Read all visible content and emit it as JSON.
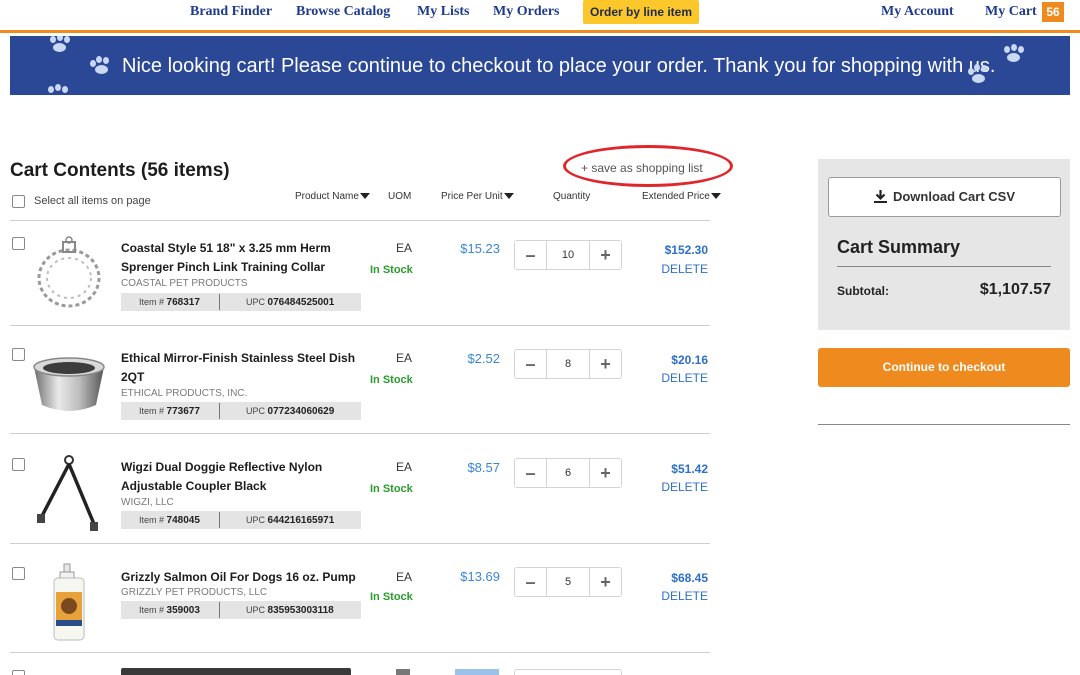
{
  "nav": {
    "brand_finder": "Brand Finder",
    "browse_catalog": "Browse Catalog",
    "my_lists": "My Lists",
    "my_orders": "My Orders",
    "order_by_line": "Order by line item",
    "my_account": "My Account",
    "my_cart": "My Cart",
    "cart_count": "56"
  },
  "banner": {
    "message": "Nice looking cart! Please continue to checkout to place your order. Thank you for shopping with us."
  },
  "cart": {
    "title": "Cart Contents (56 items)",
    "save_list": "+ save as shopping list",
    "select_all": "Select all items on page",
    "columns": {
      "product": "Product Name",
      "uom": "UOM",
      "ppu": "Price Per Unit",
      "qty": "Quantity",
      "ext": "Extended Price"
    },
    "items": [
      {
        "name": "Coastal Style 51 18\" x 3.25 mm Herm Sprenger Pinch Link Training Collar",
        "brand": "COASTAL PET PRODUCTS",
        "item_label": "Item #",
        "item_no": "768317",
        "upc_label": "UPC",
        "upc": "076484525001",
        "uom": "EA",
        "stock": "In Stock",
        "price": "$15.23",
        "qty": "10",
        "ext": "$152.30",
        "delete": "DELETE"
      },
      {
        "name": "Ethical Mirror-Finish Stainless Steel Dish 2QT",
        "brand": "ETHICAL PRODUCTS, INC.",
        "item_label": "Item #",
        "item_no": "773677",
        "upc_label": "UPC",
        "upc": "077234060629",
        "uom": "EA",
        "stock": "In Stock",
        "price": "$2.52",
        "qty": "8",
        "ext": "$20.16",
        "delete": "DELETE"
      },
      {
        "name": "Wigzi Dual Doggie Reflective Nylon Adjustable Coupler Black",
        "brand": "WIGZI, LLC",
        "item_label": "Item #",
        "item_no": "748045",
        "upc_label": "UPC",
        "upc": "644216165971",
        "uom": "EA",
        "stock": "In Stock",
        "price": "$8.57",
        "qty": "6",
        "ext": "$51.42",
        "delete": "DELETE"
      },
      {
        "name": "Grizzly Salmon Oil For Dogs 16 oz. Pump",
        "brand": "GRIZZLY PET PRODUCTS, LLC",
        "item_label": "Item #",
        "item_no": "359003",
        "upc_label": "UPC",
        "upc": "835953003118",
        "uom": "EA",
        "stock": "In Stock",
        "price": "$13.69",
        "qty": "5",
        "ext": "$68.45",
        "delete": "DELETE"
      }
    ]
  },
  "summary": {
    "download": "Download Cart CSV",
    "title": "Cart Summary",
    "subtotal_label": "Subtotal:",
    "subtotal": "$1,107.57",
    "checkout": "Continue to checkout"
  },
  "colors": {
    "nav_text": "#1f3c8c",
    "accent_orange": "#ef8b1e",
    "order_btn": "#fbc72b",
    "banner_bg": "#2a4896",
    "price_blue": "#3a86d6",
    "in_stock_green": "#2a9d2a",
    "highlight_red": "#e0262a"
  }
}
